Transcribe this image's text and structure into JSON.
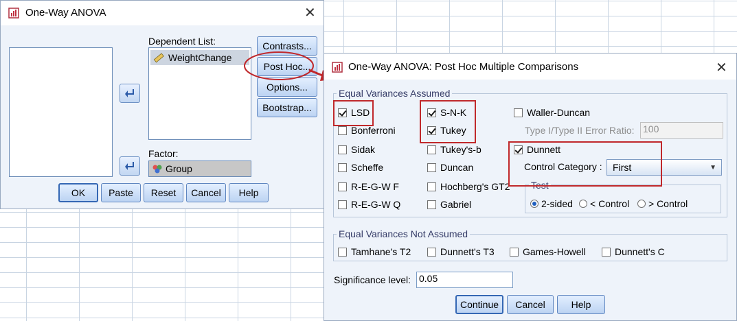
{
  "main_dialog": {
    "title": "One-Way ANOVA",
    "dependent_list_label": "Dependent List:",
    "dependent_items": [
      "WeightChange"
    ],
    "factor_label": "Factor:",
    "factor_value": "Group",
    "side_buttons": [
      "Contrasts...",
      "Post Hoc...",
      "Options...",
      "Bootstrap..."
    ],
    "bottom_buttons": [
      "OK",
      "Paste",
      "Reset",
      "Cancel",
      "Help"
    ]
  },
  "posthoc_dialog": {
    "title": "One-Way ANOVA: Post Hoc Multiple Comparisons",
    "equal_group_label": "Equal Variances Assumed",
    "equal_checks": [
      {
        "label": "LSD",
        "checked": true
      },
      {
        "label": "Bonferroni",
        "checked": false
      },
      {
        "label": "Sidak",
        "checked": false
      },
      {
        "label": "Scheffe",
        "checked": false
      },
      {
        "label": "R-E-G-W F",
        "checked": false
      },
      {
        "label": "R-E-G-W Q",
        "checked": false
      },
      {
        "label": "S-N-K",
        "checked": true
      },
      {
        "label": "Tukey",
        "checked": true
      },
      {
        "label": "Tukey's-b",
        "checked": false
      },
      {
        "label": "Duncan",
        "checked": false
      },
      {
        "label": "Hochberg's GT2",
        "checked": false
      },
      {
        "label": "Gabriel",
        "checked": false
      },
      {
        "label": "Waller-Duncan",
        "checked": false
      },
      {
        "label": "Dunnett",
        "checked": true
      }
    ],
    "error_ratio_label": "Type I/Type II Error Ratio:",
    "error_ratio_value": "100",
    "control_category_label": "Control Category :",
    "control_category_value": "First",
    "test_group_label": "Test",
    "test_options": [
      {
        "label": "2-sided",
        "selected": true
      },
      {
        "label": "< Control",
        "selected": false
      },
      {
        "label": "> Control",
        "selected": false
      }
    ],
    "not_equal_group_label": "Equal Variances Not Assumed",
    "not_equal_checks": [
      {
        "label": "Tamhane's T2",
        "checked": false
      },
      {
        "label": "Dunnett's T3",
        "checked": false
      },
      {
        "label": "Games-Howell",
        "checked": false
      },
      {
        "label": "Dunnett's C",
        "checked": false
      }
    ],
    "significance_label": "Significance level:",
    "significance_value": "0.05",
    "buttons": [
      "Continue",
      "Cancel",
      "Help"
    ]
  },
  "colors": {
    "highlight_red": "#c0282b",
    "dialog_bg": "#eef3fa",
    "button_border": "#5f86c0"
  }
}
